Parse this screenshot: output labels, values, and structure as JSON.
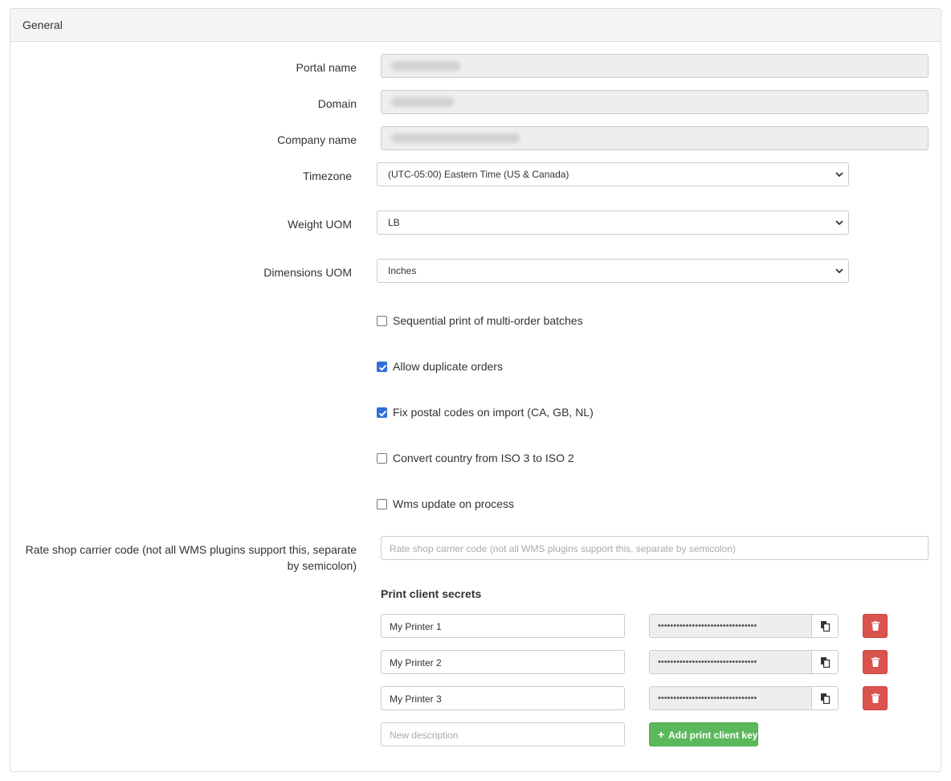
{
  "panel": {
    "title": "General"
  },
  "fields": {
    "portal_name_label": "Portal name",
    "domain_label": "Domain",
    "company_name_label": "Company name",
    "timezone_label": "Timezone",
    "timezone_value": "(UTC-05:00) Eastern Time (US & Canada)",
    "weight_uom_label": "Weight UOM",
    "weight_uom_value": "LB",
    "dimensions_uom_label": "Dimensions UOM",
    "dimensions_uom_value": "Inches"
  },
  "checkboxes": [
    {
      "label": "Sequential print of multi-order batches",
      "checked": false
    },
    {
      "label": "Allow duplicate orders",
      "checked": true
    },
    {
      "label": "Fix postal codes on import (CA, GB, NL)",
      "checked": true
    },
    {
      "label": "Convert country from ISO 3 to ISO 2",
      "checked": false
    },
    {
      "label": "Wms update on process",
      "checked": false
    }
  ],
  "rate_shop": {
    "label_line1": "Rate shop carrier code (not all WMS plugins support this, separate",
    "label_line2": "by semicolon)",
    "placeholder": "Rate shop carrier code (not all WMS plugins support this, separate by semicolon)"
  },
  "print_clients": {
    "title": "Print client secrets",
    "rows": [
      {
        "description": "My Printer 1",
        "secret": "••••••••••••••••••••••••••••••••"
      },
      {
        "description": "My Printer 2",
        "secret": "••••••••••••••••••••••••••••••••"
      },
      {
        "description": "My Printer 3",
        "secret": "••••••••••••••••••••••••••••••••"
      }
    ],
    "new_placeholder": "New description",
    "add_button": "Add print client key",
    "add_icon": "+"
  },
  "icons": {
    "copy": "copy-icon",
    "delete": "trash-icon",
    "chevron": "chevron-down-icon"
  },
  "colors": {
    "danger": "#d9534f",
    "success": "#5cb85c",
    "checkbox": "#2f6fd6"
  }
}
